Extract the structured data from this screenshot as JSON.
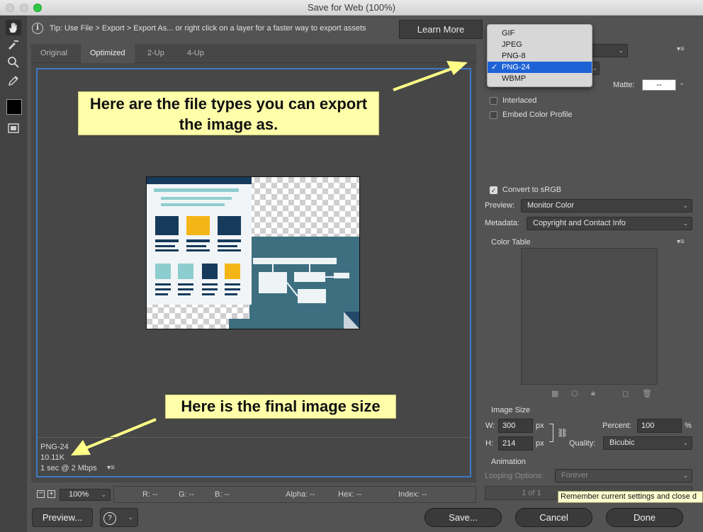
{
  "window": {
    "title": "Save for Web (100%)"
  },
  "tip": {
    "icon": "info-icon",
    "text": "Tip: Use File > Export > Export As...  or right click on a layer for a faster way to export assets",
    "learn_more": "Learn More"
  },
  "tabs": [
    "Original",
    "Optimized",
    "2-Up",
    "4-Up"
  ],
  "active_tab": "Optimized",
  "callouts": {
    "file_types": "Here are the file types you can export the image as.",
    "final_size": "Here is the final image size"
  },
  "status": {
    "format": "PNG-24",
    "size": "10.11K",
    "speed": "1 sec @ 2 Mbps"
  },
  "bottom_bar": {
    "zoom": "100%",
    "r": "R: --",
    "g": "G: --",
    "b": "B: --",
    "alpha": "Alpha: --",
    "hex": "Hex: --",
    "index": "Index: --"
  },
  "buttons": {
    "preview": "Preview...",
    "save": "Save...",
    "cancel": "Cancel",
    "done": "Done"
  },
  "format_menu": {
    "options": [
      "GIF",
      "JPEG",
      "PNG-8",
      "PNG-24",
      "WBMP"
    ],
    "selected": "PNG-24",
    "check": "✓"
  },
  "settings": {
    "matte_label": "Matte:",
    "matte_value": "--",
    "interlaced": "Interlaced",
    "embed_color_profile": "Embed Color Profile",
    "convert_srgb": "Convert to sRGB",
    "preview_label": "Preview:",
    "preview_value": "Monitor Color",
    "metadata_label": "Metadata:",
    "metadata_value": "Copyright and Contact Info",
    "color_table": "Color Table"
  },
  "image_size": {
    "header": "Image Size",
    "w_label": "W:",
    "w": "300",
    "h_label": "H:",
    "h": "214",
    "unit": "px",
    "percent_label": "Percent:",
    "percent": "100",
    "percent_unit": "%",
    "quality_label": "Quality:",
    "quality": "Bicubic"
  },
  "animation": {
    "header": "Animation",
    "looping_label": "Looping Options:",
    "looping_value": "Forever",
    "frame_counter": "1 of 1"
  },
  "tooltip": "Remember current settings and close d",
  "colors": {
    "callout_bg": "#ffffaa",
    "frame_blue": "#3c79c4",
    "menu_selected": "#1e63d6"
  }
}
